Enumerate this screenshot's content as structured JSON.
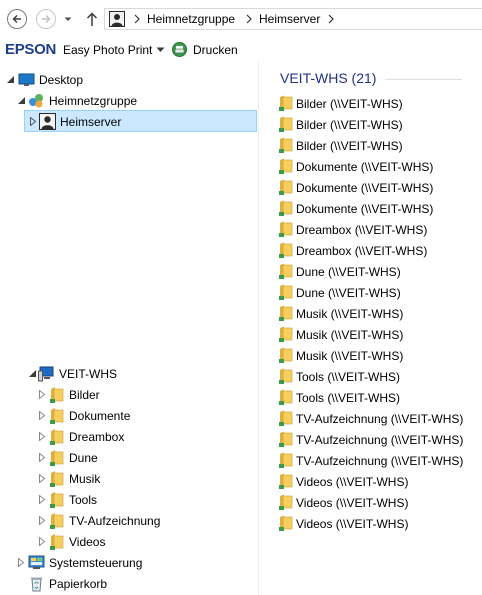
{
  "address_bar": {
    "breadcrumbs": [
      "Heimnetzgruppe",
      "Heimserver"
    ]
  },
  "command_bar": {
    "brand": "EPSON",
    "easy_photo_print": "Easy Photo Print",
    "print_label": "Drucken"
  },
  "nav_tree": {
    "desktop": "Desktop",
    "homegroup": "Heimnetzgruppe",
    "heimserver": "Heimserver",
    "computer": "VEIT-WHS",
    "folders": [
      "Bilder",
      "Dokumente",
      "Dreambox",
      "Dune",
      "Musik",
      "Tools",
      "TV-Aufzeichnung",
      "Videos"
    ],
    "control_panel": "Systemsteuerung",
    "recycle_bin": "Papierkorb"
  },
  "content": {
    "group_title": "VEIT-WHS (21)",
    "items": [
      "Bilder (\\\\VEIT-WHS)",
      "Bilder (\\\\VEIT-WHS)",
      "Bilder (\\\\VEIT-WHS)",
      "Dokumente (\\\\VEIT-WHS)",
      "Dokumente (\\\\VEIT-WHS)",
      "Dokumente (\\\\VEIT-WHS)",
      "Dreambox (\\\\VEIT-WHS)",
      "Dreambox (\\\\VEIT-WHS)",
      "Dune (\\\\VEIT-WHS)",
      "Dune (\\\\VEIT-WHS)",
      "Musik (\\\\VEIT-WHS)",
      "Musik (\\\\VEIT-WHS)",
      "Musik (\\\\VEIT-WHS)",
      "Tools (\\\\VEIT-WHS)",
      "Tools (\\\\VEIT-WHS)",
      "TV-Aufzeichnung (\\\\VEIT-WHS)",
      "TV-Aufzeichnung (\\\\VEIT-WHS)",
      "TV-Aufzeichnung (\\\\VEIT-WHS)",
      "Videos (\\\\VEIT-WHS)",
      "Videos (\\\\VEIT-WHS)",
      "Videos (\\\\VEIT-WHS)"
    ]
  },
  "colors": {
    "selection_bg": "#cce8ff",
    "selection_border": "#99d1ff",
    "group_title": "#1e3287",
    "epson_blue": "#1e3d8f",
    "folder_yellow": "#f6cf5e"
  },
  "icons": {
    "back": "back-arrow-icon",
    "forward": "forward-arrow-icon",
    "up": "up-arrow-icon",
    "folder": "shared-folder-icon",
    "print": "print-icon"
  }
}
